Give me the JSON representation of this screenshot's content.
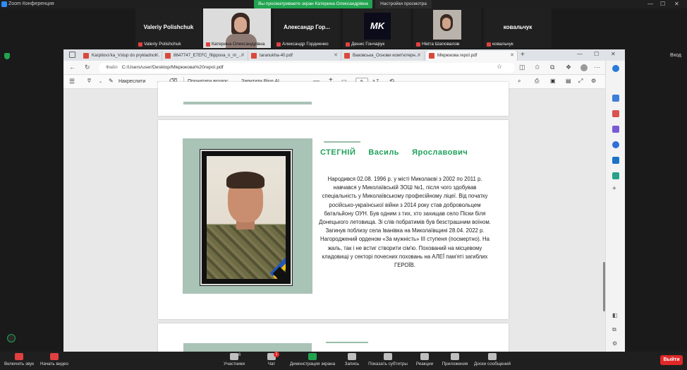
{
  "zoom": {
    "title": "Zoom Конференция",
    "share_banner": "Вы просматриваете экран Катерина Олександрівна",
    "view_options": "Настройки просмотра",
    "sign_in": "Вход",
    "participants": [
      {
        "big": "Valeriy Polishchuk",
        "small": "Valeriy Polishchuk"
      },
      {
        "big": "",
        "small": "Катерина Олександрівна"
      },
      {
        "big": "Александр  Гор...",
        "small": "Александр Гордиенко"
      },
      {
        "big": "",
        "small": "Денис Гончарук"
      },
      {
        "big": "",
        "small": "Нікіта Шаповалов"
      },
      {
        "big": "ковальчук",
        "small": "ковальчук"
      }
    ],
    "participant_logo": "MK",
    "bottom": {
      "mute": "Включить звук",
      "video": "Начать видео",
      "participants": "Участники",
      "participants_count": "6",
      "chat": "Чат",
      "chat_badge": "1",
      "share": "Демонстрация экрана",
      "record": "Запись",
      "subtitles": "Показать субтитры",
      "reactions": "Реакции",
      "apps": "Приложения",
      "whiteboard": "Доски сообщений",
      "end": "Выйти"
    }
  },
  "browser": {
    "tabs": [
      "Karpilovs'ka_Vstup do prykladnoi...",
      "8647747_E7EFC_filippova_n_m_...",
      "taranukha-40.pdf",
      "Ваковська_Основи комп'ютерн...",
      "Мікрюкова герої.pdf"
    ],
    "address_prefix": "Файл",
    "address": "C:/Users/user/Desktop/Мікрюкова%20герої.pdf",
    "pdf_toolbar": {
      "draw": "Накреслити",
      "read_aloud": "Прочитати вголос",
      "ask_bing": "Запитати Bing AI",
      "page": "5",
      "page_total": "з 7"
    }
  },
  "hero": {
    "surname": "СТЕГНІЙ",
    "first": "Василь",
    "patronymic": "Ярославович",
    "bio": "Народився 02.08. 1996 р. у місті Миколаєві з 2002 по 2011 р. навчався у Миколаївській ЗОШ №1, після чого здобував спеціальність у Миколаївському професійному ліцеї. Від початку російсько-української війни з 2014 року став добровольцем батальйону ОУН. Був одним з тих, хто захищав село Піски біля Донецького летовища. Зі слів побратимів був безстрашним воїном. Загинув поблизу села Іванівка на Миколаївщині 28.04. 2022 р. Нагороджений орденом «За мужність» ІІІ ступеня (посмертно). На жаль, так і не встиг створити сім'ю. Похований на місцевому кладовищі у секторі почесних поховань на АЛЕЇ пам'яті загиблих ГЕРОЇВ."
  },
  "colors": {
    "accent_green": "#1fa15a",
    "photo_bg": "#a9c3b6",
    "end_red": "#e02828"
  }
}
